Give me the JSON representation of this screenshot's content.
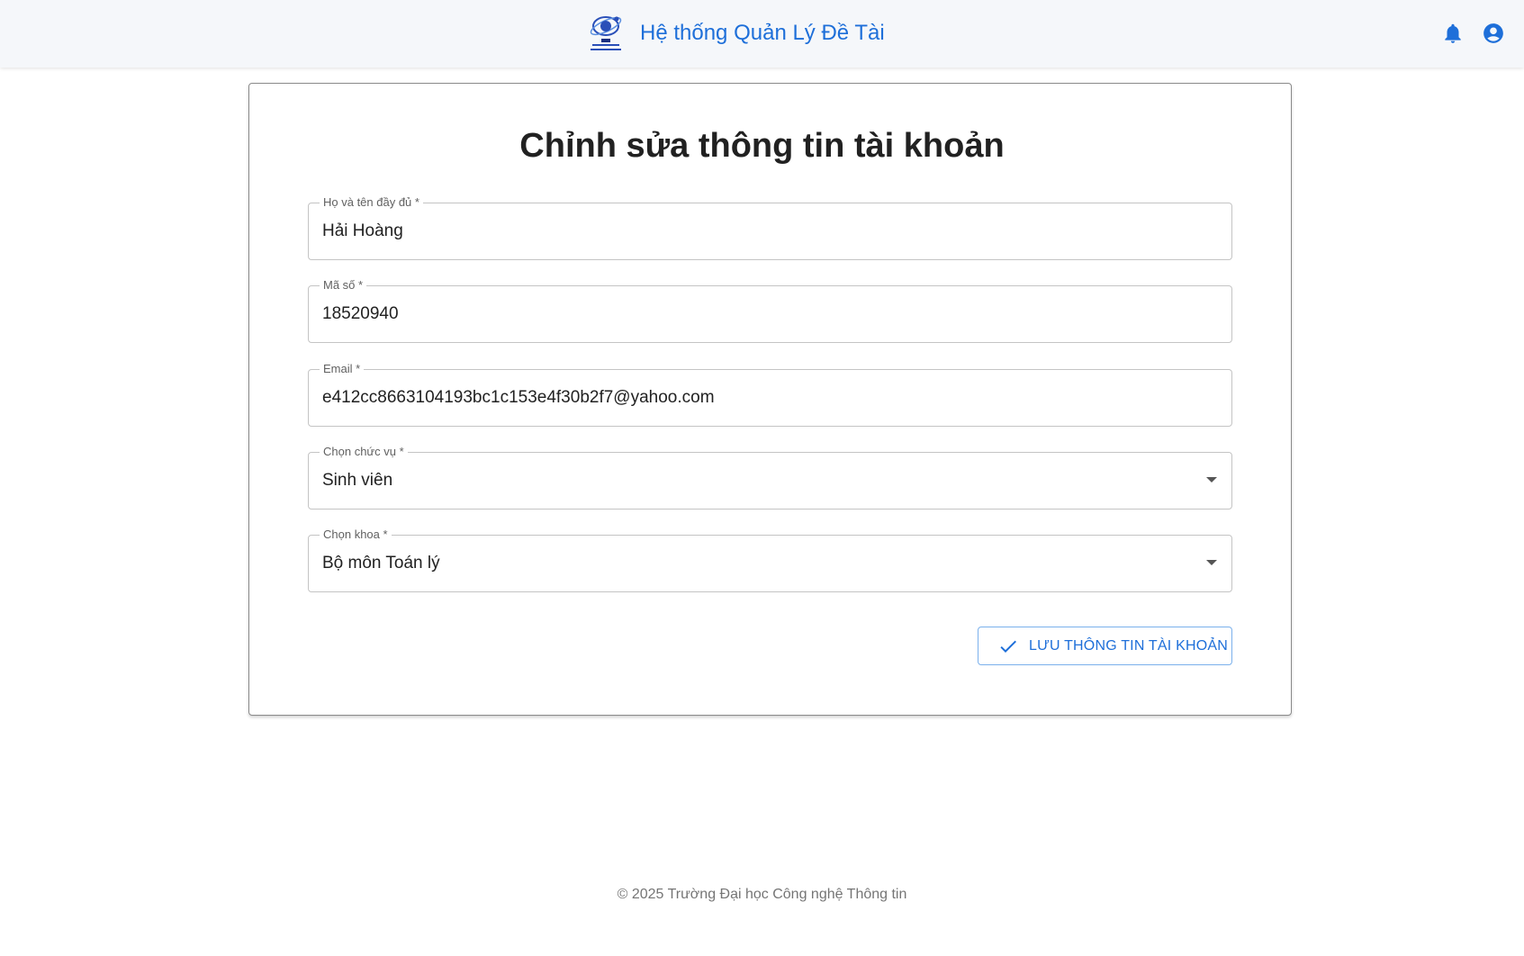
{
  "header": {
    "title": "Hệ thống Quản Lý Đề Tài",
    "logo_text": "UIT",
    "icons": [
      "uit-logo",
      "bell-icon",
      "account-circle-icon"
    ],
    "accent_color": "#1e6fd9"
  },
  "form": {
    "title": "Chỉnh sửa thông tin tài khoản",
    "fields": [
      {
        "label": "Họ và tên đầy đủ *",
        "value": "Hải Hoàng",
        "type": "text"
      },
      {
        "label": "Mã số *",
        "value": "18520940",
        "type": "text"
      },
      {
        "label": "Email *",
        "value": "e412cc8663104193bc1c153e4f30b2f7@yahoo.com",
        "type": "text"
      },
      {
        "label": "Chọn chức vụ *",
        "value": "Sinh viên",
        "type": "select"
      },
      {
        "label": "Chọn khoa *",
        "value": "Bộ môn Toán lý",
        "type": "select"
      }
    ],
    "save_label": "LƯU THÔNG TIN TÀI KHOẢN"
  },
  "footer": {
    "text": "© 2025 Trường Đại học Công nghệ Thông tin"
  }
}
